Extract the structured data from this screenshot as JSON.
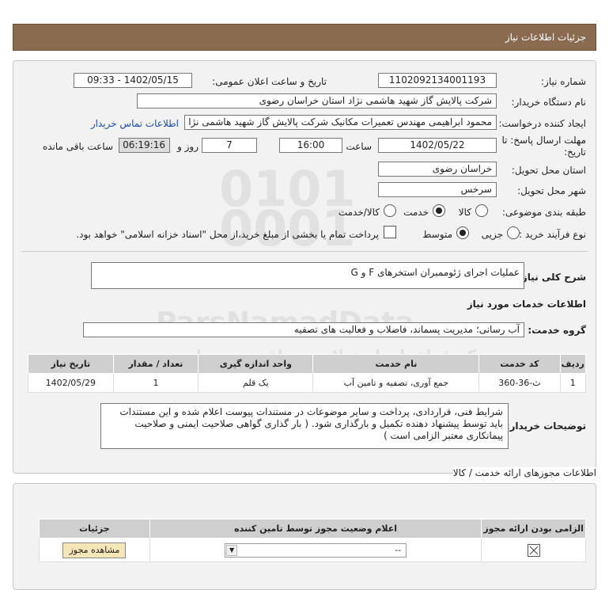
{
  "header": {
    "title": "جزئیات اطلاعات نیاز"
  },
  "fields": {
    "need_number_label": "شماره نیاز:",
    "need_number": "1102092134001193",
    "announce_label": "تاریخ و ساعت اعلان عمومی:",
    "announce_value": "1402/05/15 - 09:33",
    "buyer_org_label": "نام دستگاه خریدار:",
    "buyer_org": "شرکت پالایش گاز شهید هاشمی نژاد   استان خراسان رضوی",
    "requester_label": "ایجاد کننده درخواست:",
    "requester": "محمود ابراهیمی مهندس تعمیرات مکانیک شرکت پالایش گاز شهید هاشمی نژا",
    "contact_link": "اطلاعات تماس خریدار",
    "deadline_label": "مهلت ارسال پاسخ: تا",
    "deadline_label2": "تاریخ:",
    "deadline_date": "1402/05/22",
    "time_label": "ساعت",
    "deadline_time": "16:00",
    "days_value": "7",
    "days_label": "روز و",
    "remaining_time": "06:19:16",
    "remaining_label": "ساعت باقی مانده",
    "province_label": "استان محل تحویل:",
    "province": "خراسان رضوی",
    "city_label": "شهر محل تحویل:",
    "city": "سرخس",
    "category_label": "طبقه بندی موضوعی:",
    "cat_goods": "کالا",
    "cat_service": "خدمت",
    "cat_goods_service": "کالا/خدمت",
    "purchase_type_label": "نوع فرآیند خرید :",
    "pt_partial": "جزیی",
    "pt_medium": "متوسط",
    "treasury_note": "پرداخت تمام یا بخشی از مبلغ خرید،از محل \"اسناد خزانه اسلامی\" خواهد بود."
  },
  "summary": {
    "label": "شرح کلی نیاز:",
    "value": "عملیات اجرای ژئوممبران استخرهای  F و G"
  },
  "services_title": "اطلاعات خدمات مورد نیاز",
  "service_group": {
    "label": "گروه خدمت:",
    "value": "آب رسانی؛ مدیریت پسماند، فاضلاب و فعالیت های تصفیه"
  },
  "table": {
    "headers": [
      "ردیف",
      "کد خدمت",
      "نام خدمت",
      "واحد اندازه گیری",
      "تعداد / مقدار",
      "تاریخ نیاز"
    ],
    "rows": [
      [
        "1",
        "ث-36-360",
        "جمع آوری، تصفیه و تامین آب",
        "یک قلم",
        "1",
        "1402/05/29"
      ]
    ]
  },
  "buyer_notes": {
    "label": "توضیحات خریدار:",
    "value": "شرایط فنی، قراردادی، پرداخت و سایر موضوعات در مستندات پیوست اعلام شده و این مستندات باید توسط پیشنهاد دهنده تکمیل و  بارگذاری شود. ( بار گذاری گواهی صلاحیت ایمنی و صلاحیت پیمانکاری معتبر الزامی است )"
  },
  "permits": {
    "title": "اطلاعات مجوزهای ارائه خدمت / کالا",
    "headers": [
      "الزامی بودن ارائه مجوز",
      "اعلام وضعیت مجوز توسط تامین کننده",
      "جزئیات"
    ],
    "select_value": "--",
    "view_button": "مشاهده مجوز"
  },
  "watermark": {
    "line1": "ParsNamadData",
    "line2": "مرکز فراخوان استعلام و مناقصه و مزایده"
  }
}
